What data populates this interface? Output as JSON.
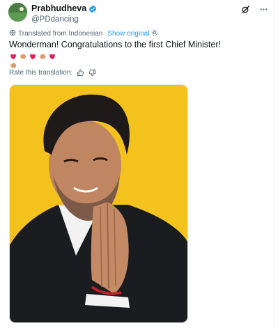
{
  "author": {
    "display_name": "Prabhudheva",
    "handle": "@PDdancing",
    "verified": true
  },
  "icons": {
    "avatar": "avatar-image",
    "verified": "verified-badge-icon",
    "grok": "grok-icon",
    "more": "more-icon",
    "translate": "translate-icon",
    "settings": "settings-icon",
    "thumbs_up": "thumbs-up-icon",
    "thumbs_down": "thumbs-down-icon"
  },
  "translation": {
    "label": "Translated from Indonesian",
    "show_original": "Show original"
  },
  "tweet": {
    "text": "Wonderman! Congratulations to the first Chief Minister!",
    "emojis": [
      "red-heart",
      "clapping-hands",
      "red-heart",
      "clapping-hands",
      "red-heart",
      "clapping-hands"
    ]
  },
  "rating": {
    "label": "Rate this translation:"
  },
  "media": {
    "subject": "man-with-folded-hands-photo",
    "background_color": "#f4c21c"
  },
  "colors": {
    "accent": "#1d9bf0",
    "secondary_text": "#536471",
    "heart": "#e0245e",
    "clap": "#e8b58a"
  }
}
